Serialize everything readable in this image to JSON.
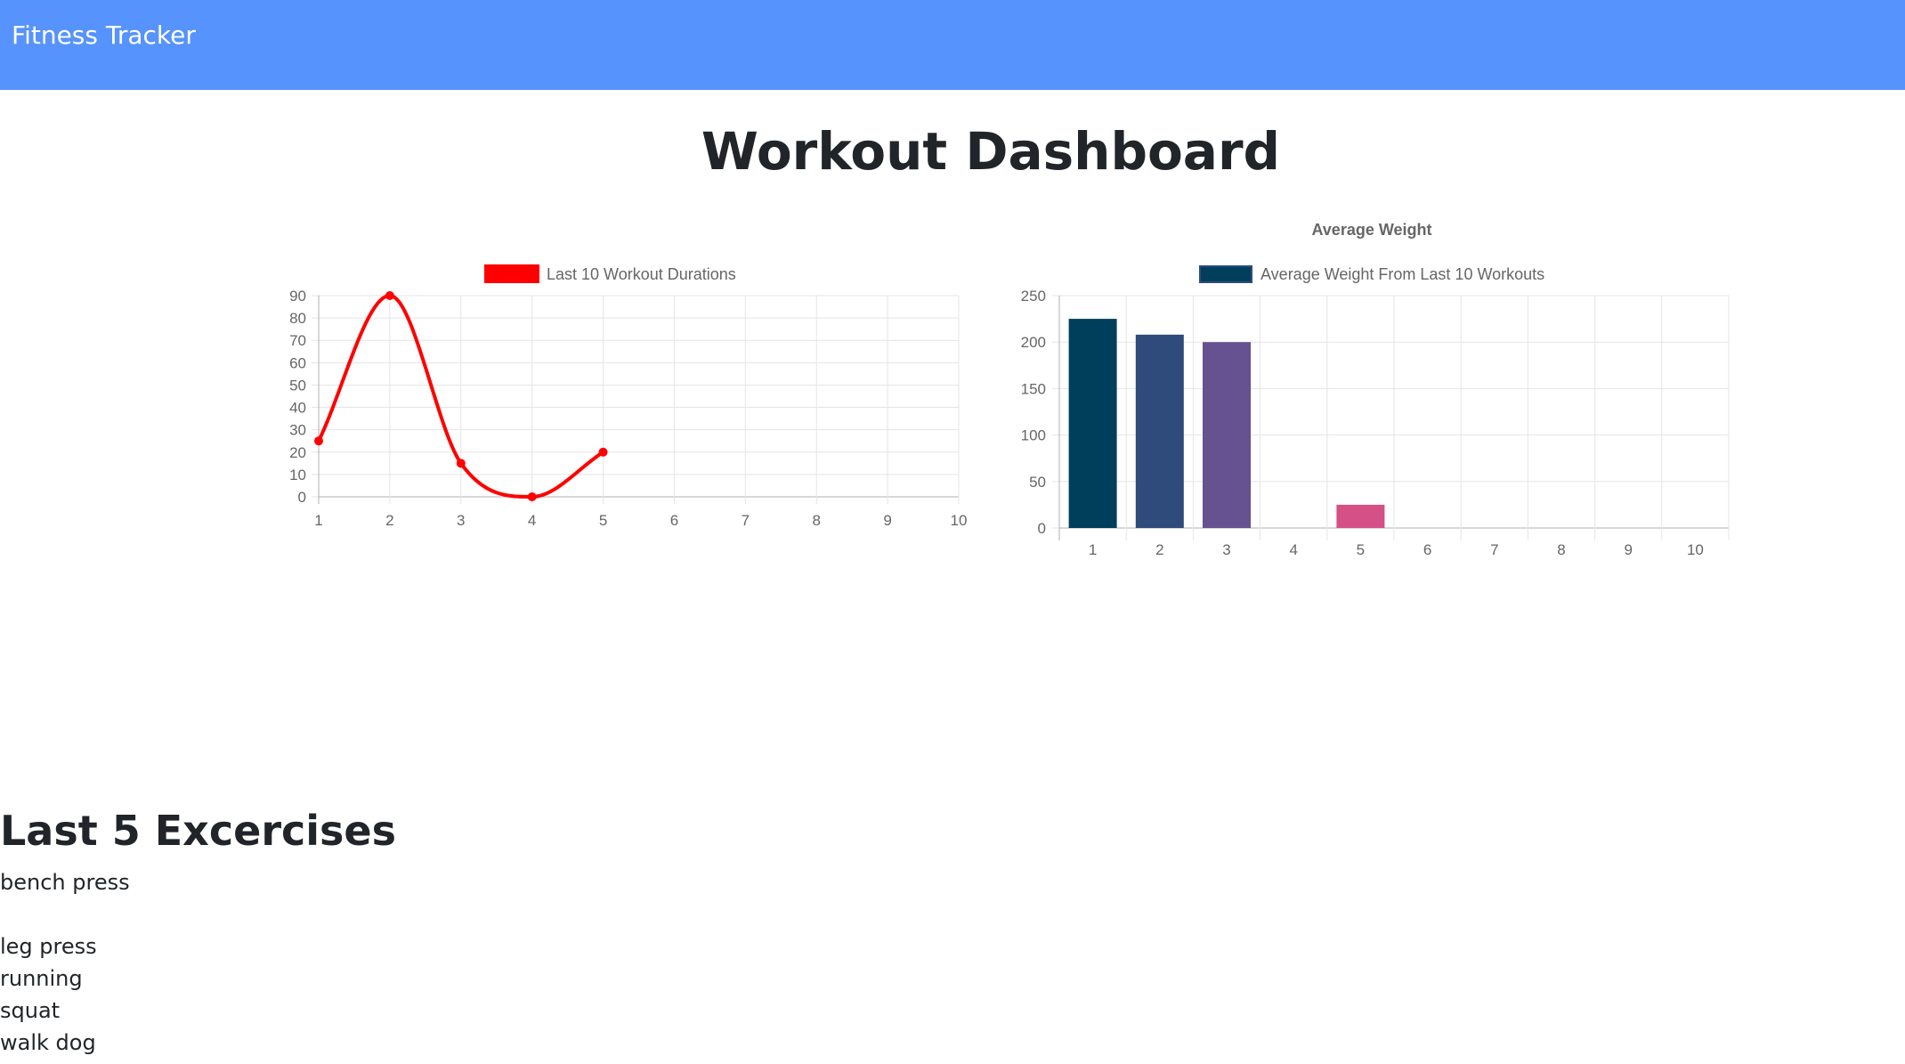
{
  "navbar": {
    "brand": "Fitness Tracker"
  },
  "page": {
    "title": "Workout Dashboard"
  },
  "chart_data": [
    {
      "type": "line",
      "title": "",
      "legend": "Last 10 Workout Durations",
      "legend_position": "top",
      "x": [
        1,
        2,
        3,
        4,
        5,
        6,
        7,
        8,
        9,
        10
      ],
      "series": [
        {
          "name": "Last 10 Workout Durations",
          "values": [
            25,
            90,
            15,
            0,
            20
          ],
          "color": "#ff0000"
        }
      ],
      "y_ticks": [
        0,
        10,
        20,
        30,
        40,
        50,
        60,
        70,
        80,
        90
      ],
      "ylim": [
        0,
        90
      ],
      "grid": true
    },
    {
      "type": "bar",
      "title": "Average Weight",
      "legend": "Average Weight From Last 10 Workouts",
      "legend_position": "top",
      "categories": [
        1,
        2,
        3,
        4,
        5,
        6,
        7,
        8,
        9,
        10
      ],
      "series": [
        {
          "name": "Average Weight From Last 10 Workouts",
          "values": [
            225,
            208,
            200,
            0,
            25,
            0,
            0,
            0,
            0,
            0
          ]
        }
      ],
      "bar_colors": [
        "#003f5c",
        "#2f4b7c",
        "#665191",
        "#a05195",
        "#d45087",
        "#f95d6a",
        "#ff7c43",
        "#ffa600",
        "#003f5c",
        "#2f4b7c"
      ],
      "legend_color": "#003f5c",
      "y_ticks": [
        0,
        50,
        100,
        150,
        200,
        250
      ],
      "ylim": [
        0,
        250
      ],
      "grid": true
    }
  ],
  "exercises": {
    "heading": "Last 5 Excercises",
    "items": [
      {
        "label": "bench press",
        "gap_after": true
      },
      {
        "label": "leg press"
      },
      {
        "label": "running"
      },
      {
        "label": "squat"
      },
      {
        "label": "walk dog"
      }
    ]
  }
}
